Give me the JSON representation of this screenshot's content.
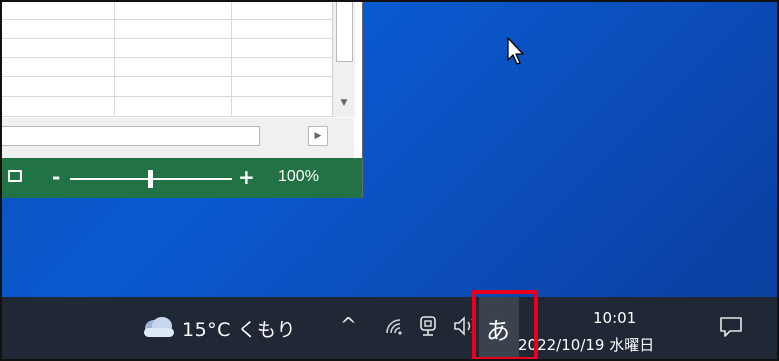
{
  "excel": {
    "zoom_label": "100%",
    "zoom_minus": "-",
    "zoom_plus": "+",
    "scroll_down_glyph": "▼",
    "scroll_right_glyph": "▶",
    "accent": "#217346",
    "icons": [
      "page-layout-icon"
    ]
  },
  "taskbar": {
    "weather": {
      "icon": "cloud-icon",
      "text": "15°C くもり"
    },
    "tray": {
      "overflow_glyph": "^",
      "icons": [
        "wifi-icon",
        "meet-now-icon",
        "volume-icon"
      ],
      "ime_mode": "あ"
    },
    "clock": {
      "time": "10:01",
      "date": "2022/10/19 水曜日"
    },
    "notification_icon": "notification-icon",
    "background": "#1f2834"
  },
  "annotation": {
    "highlight_color": "#e8001c"
  }
}
